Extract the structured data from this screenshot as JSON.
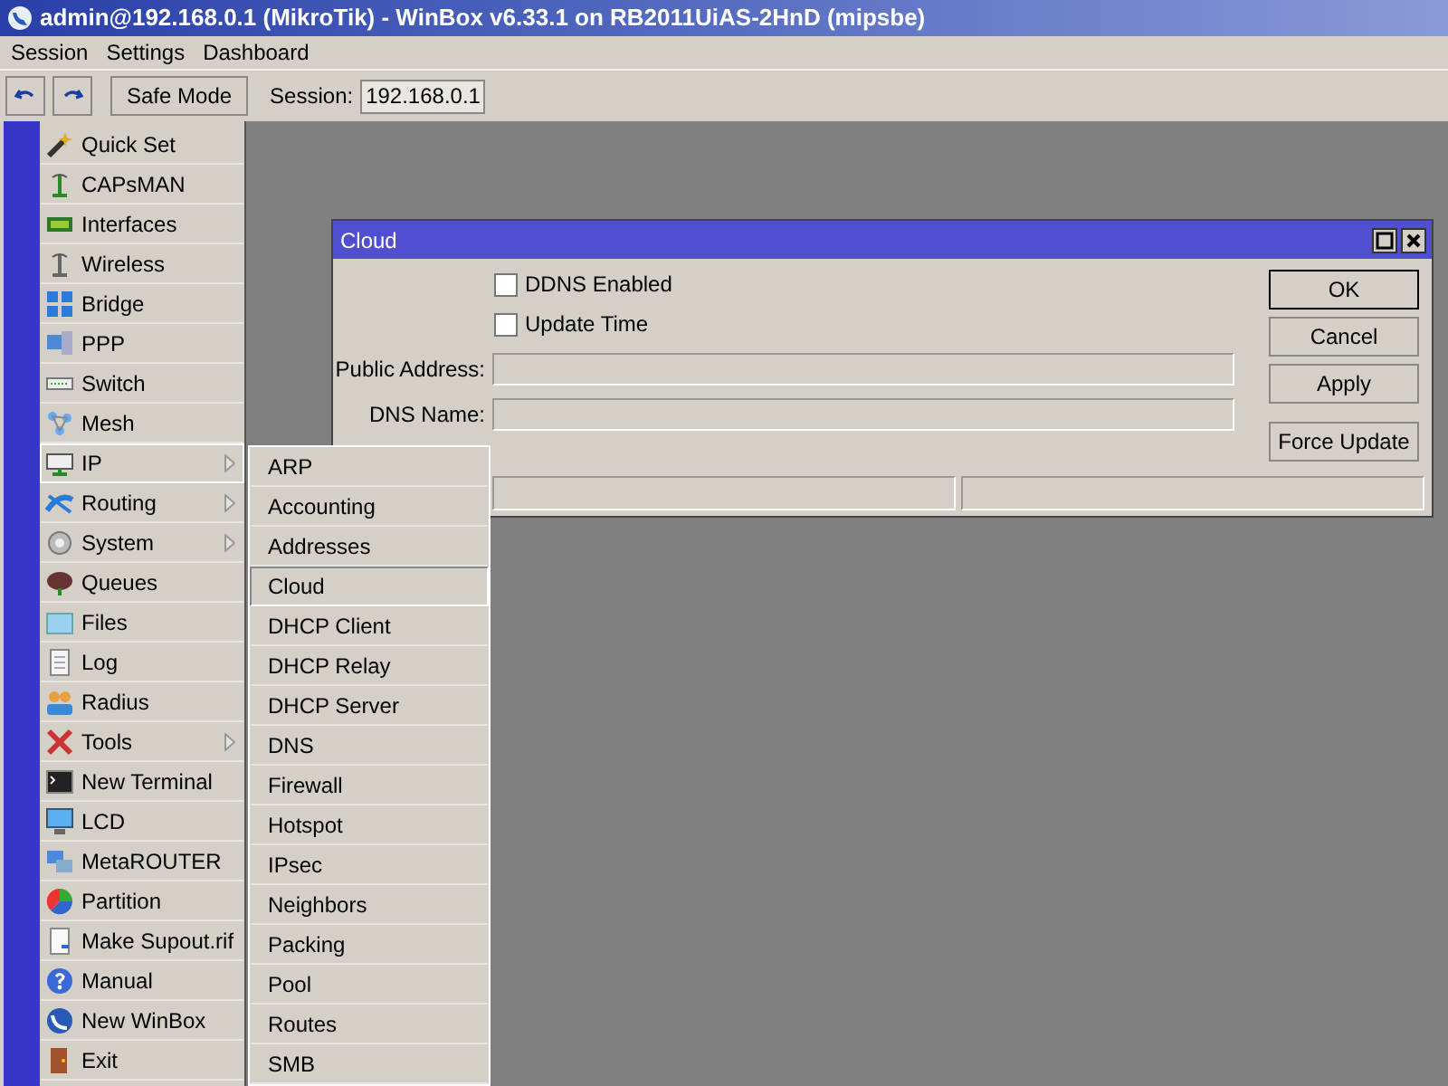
{
  "window": {
    "title": "admin@192.168.0.1 (MikroTik) - WinBox v6.33.1 on RB2011UiAS-2HnD (mipsbe)"
  },
  "menu_bar": [
    "Session",
    "Settings",
    "Dashboard"
  ],
  "toolbar": {
    "safe_mode": "Safe Mode",
    "session_label": "Session:",
    "session_value": "192.168.0.1"
  },
  "sidebar": {
    "items": [
      {
        "label": "Quick Set",
        "selected": false,
        "submenu": false
      },
      {
        "label": "CAPsMAN",
        "selected": false,
        "submenu": false
      },
      {
        "label": "Interfaces",
        "selected": false,
        "submenu": false
      },
      {
        "label": "Wireless",
        "selected": false,
        "submenu": false
      },
      {
        "label": "Bridge",
        "selected": false,
        "submenu": false
      },
      {
        "label": "PPP",
        "selected": false,
        "submenu": false
      },
      {
        "label": "Switch",
        "selected": false,
        "submenu": false
      },
      {
        "label": "Mesh",
        "selected": false,
        "submenu": false
      },
      {
        "label": "IP",
        "selected": true,
        "submenu": true
      },
      {
        "label": "Routing",
        "selected": false,
        "submenu": true
      },
      {
        "label": "System",
        "selected": false,
        "submenu": true
      },
      {
        "label": "Queues",
        "selected": false,
        "submenu": false
      },
      {
        "label": "Files",
        "selected": false,
        "submenu": false
      },
      {
        "label": "Log",
        "selected": false,
        "submenu": false
      },
      {
        "label": "Radius",
        "selected": false,
        "submenu": false
      },
      {
        "label": "Tools",
        "selected": false,
        "submenu": true
      },
      {
        "label": "New Terminal",
        "selected": false,
        "submenu": false
      },
      {
        "label": "LCD",
        "selected": false,
        "submenu": false
      },
      {
        "label": "MetaROUTER",
        "selected": false,
        "submenu": false
      },
      {
        "label": "Partition",
        "selected": false,
        "submenu": false
      },
      {
        "label": "Make Supout.rif",
        "selected": false,
        "submenu": false
      },
      {
        "label": "Manual",
        "selected": false,
        "submenu": false
      },
      {
        "label": "New WinBox",
        "selected": false,
        "submenu": false
      },
      {
        "label": "Exit",
        "selected": false,
        "submenu": false
      }
    ]
  },
  "submenu": {
    "items": [
      {
        "label": "ARP",
        "selected": false
      },
      {
        "label": "Accounting",
        "selected": false
      },
      {
        "label": "Addresses",
        "selected": false
      },
      {
        "label": "Cloud",
        "selected": true
      },
      {
        "label": "DHCP Client",
        "selected": false
      },
      {
        "label": "DHCP Relay",
        "selected": false
      },
      {
        "label": "DHCP Server",
        "selected": false
      },
      {
        "label": "DNS",
        "selected": false
      },
      {
        "label": "Firewall",
        "selected": false
      },
      {
        "label": "Hotspot",
        "selected": false
      },
      {
        "label": "IPsec",
        "selected": false
      },
      {
        "label": "Neighbors",
        "selected": false
      },
      {
        "label": "Packing",
        "selected": false
      },
      {
        "label": "Pool",
        "selected": false
      },
      {
        "label": "Routes",
        "selected": false
      },
      {
        "label": "SMB",
        "selected": false
      }
    ]
  },
  "dialog": {
    "title": "Cloud",
    "checkboxes": [
      {
        "label": "DDNS Enabled",
        "checked": false
      },
      {
        "label": "Update Time",
        "checked": false
      }
    ],
    "fields": [
      {
        "label": "Public Address:"
      },
      {
        "label": "DNS Name:"
      }
    ],
    "buttons": [
      {
        "label": "OK",
        "default": true
      },
      {
        "label": "Cancel",
        "default": false
      },
      {
        "label": "Apply",
        "default": false
      },
      {
        "label": "Force Update",
        "default": false
      }
    ]
  }
}
